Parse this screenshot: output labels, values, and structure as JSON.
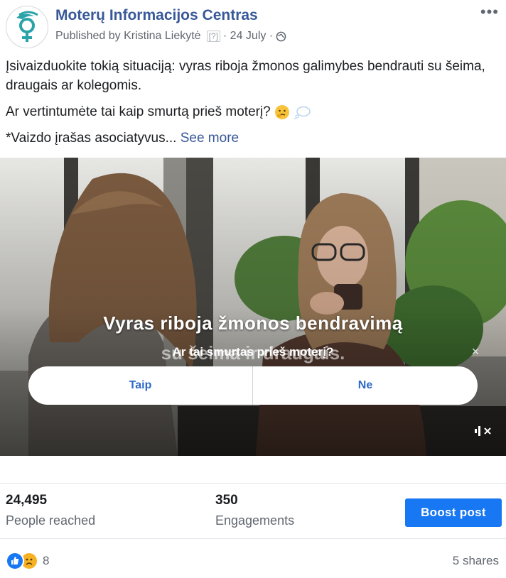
{
  "header": {
    "page_name": "Moterų Informacijos Centras",
    "published_prefix": "Published by Kristina Liekytė",
    "help_mark": "[?]",
    "date": "· 24 July ·"
  },
  "post": {
    "line1": "Įsivaizduokite tokią situaciją: vyras riboja žmonos galimybes bendrauti su šeima, draugais ar kolegomis.",
    "line2": "Ar vertintumėte tai kaip smurtą prieš moterį?",
    "line3": "*Vaizdo įrašas asociatyvus...",
    "see_more": "See more"
  },
  "video": {
    "title": "Vyras riboja žmonos bendravimą",
    "title_line2": "su šeima ir draugais.",
    "question": "Ar tai smurtas prieš moterį?",
    "close_symbol": "×",
    "poll_yes": "Taip",
    "poll_no": "Ne"
  },
  "stats": {
    "reached_value": "24,495",
    "reached_label": "People reached",
    "engagements_value": "350",
    "engagements_label": "Engagements",
    "boost_label": "Boost post"
  },
  "footer": {
    "reaction_count": "8",
    "shares": "5 shares"
  },
  "colors": {
    "brand_link": "#385898",
    "boost_blue": "#1877f2",
    "poll_text": "#2d69c8"
  }
}
